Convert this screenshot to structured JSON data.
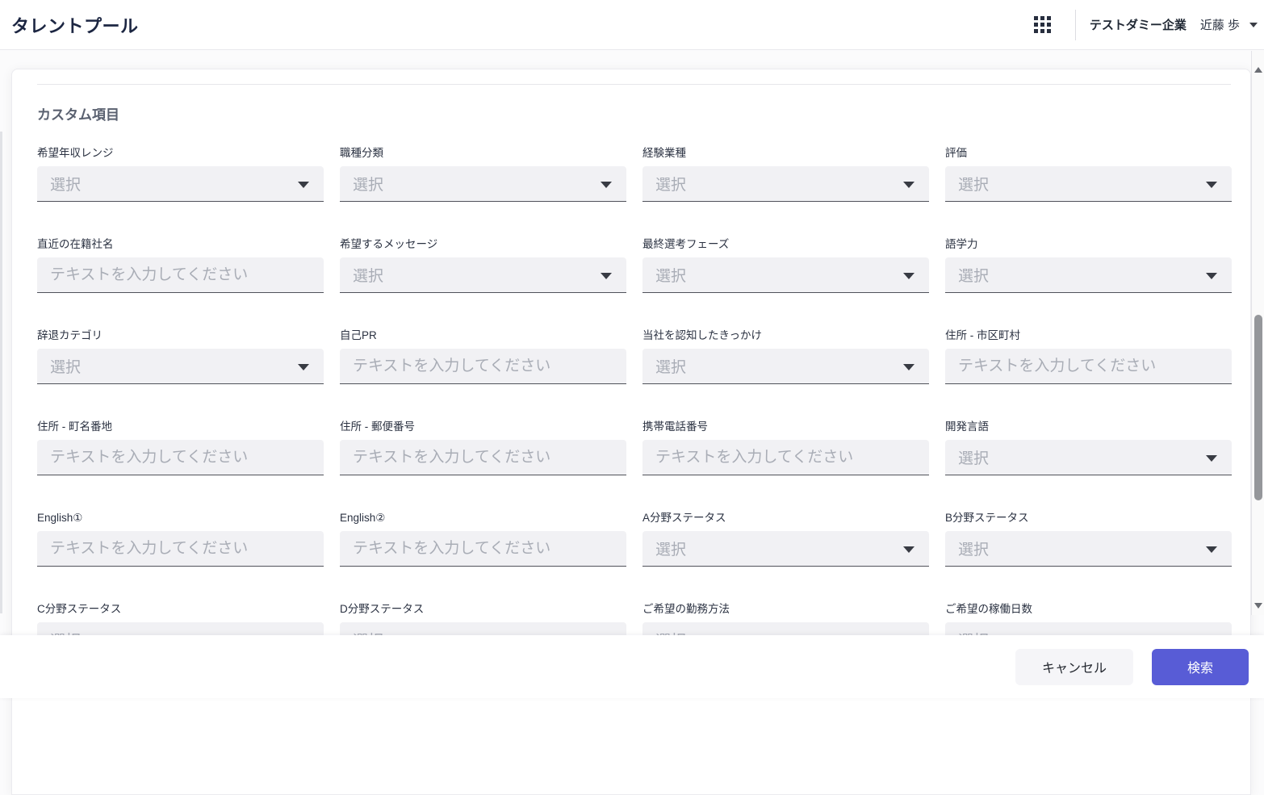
{
  "header": {
    "title": "タレントプール",
    "company": "テストダミー企業",
    "user": "近藤 歩"
  },
  "panel": {
    "section_title": "カスタム項目",
    "select_placeholder": "選択",
    "text_placeholder": "テキストを入力してください",
    "fields": [
      {
        "label": "希望年収レンジ",
        "name": "desired-salary-range",
        "type": "select"
      },
      {
        "label": "職種分類",
        "name": "job-category",
        "type": "select"
      },
      {
        "label": "経験業種",
        "name": "experienced-industry",
        "type": "select"
      },
      {
        "label": "評価",
        "name": "rating",
        "type": "select"
      },
      {
        "label": "直近の在籍社名",
        "name": "recent-company-name",
        "type": "text"
      },
      {
        "label": "希望するメッセージ",
        "name": "desired-message",
        "type": "select"
      },
      {
        "label": "最終選考フェーズ",
        "name": "final-selection-phase",
        "type": "select"
      },
      {
        "label": "語学力",
        "name": "language-skill",
        "type": "select"
      },
      {
        "label": "辞退カテゴリ",
        "name": "decline-category",
        "type": "select"
      },
      {
        "label": "自己PR",
        "name": "self-pr",
        "type": "text"
      },
      {
        "label": "当社を認知したきっかけ",
        "name": "how-learned-about-us",
        "type": "select"
      },
      {
        "label": "住所 - 市区町村",
        "name": "address-city",
        "type": "text"
      },
      {
        "label": "住所 - 町名番地",
        "name": "address-street",
        "type": "text"
      },
      {
        "label": "住所 - 郵便番号",
        "name": "address-postal-code",
        "type": "text"
      },
      {
        "label": "携帯電話番号",
        "name": "mobile-phone-number",
        "type": "text"
      },
      {
        "label": "開発言語",
        "name": "development-language",
        "type": "select"
      },
      {
        "label": "English①",
        "name": "english-1",
        "type": "text"
      },
      {
        "label": "English②",
        "name": "english-2",
        "type": "text"
      },
      {
        "label": "A分野ステータス",
        "name": "field-a-status",
        "type": "select"
      },
      {
        "label": "B分野ステータス",
        "name": "field-b-status",
        "type": "select"
      },
      {
        "label": "C分野ステータス",
        "name": "field-c-status",
        "type": "select"
      },
      {
        "label": "D分野ステータス",
        "name": "field-d-status",
        "type": "select"
      },
      {
        "label": "ご希望の勤務方法",
        "name": "preferred-work-style",
        "type": "select"
      },
      {
        "label": "ご希望の稼働日数",
        "name": "preferred-working-days",
        "type": "select"
      }
    ]
  },
  "footer": {
    "cancel_label": "キャンセル",
    "search_label": "検索"
  },
  "colors": {
    "accent": "#585cd6",
    "title_text": "#1c2642",
    "field_background": "#f1f1f4",
    "placeholder_text": "#a9adb6"
  }
}
